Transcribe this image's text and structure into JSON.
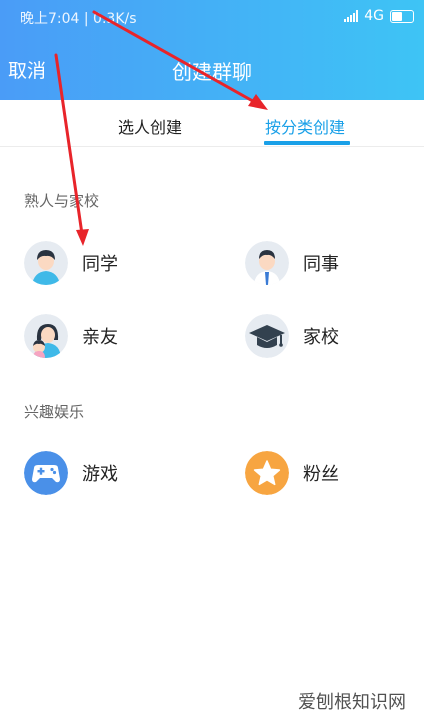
{
  "status_bar": {
    "time": "晚上7:04 | 0.3K/s",
    "network": "4G"
  },
  "header": {
    "cancel_label": "取消",
    "title": "创建群聊"
  },
  "tabs": [
    {
      "label": "选人创建"
    },
    {
      "label": "按分类创建"
    }
  ],
  "sections": [
    {
      "title": "熟人与家校",
      "items": [
        {
          "label": "同学",
          "icon": "classmate-avatar-icon"
        },
        {
          "label": "同事",
          "icon": "colleague-avatar-icon"
        },
        {
          "label": "亲友",
          "icon": "relatives-avatar-icon"
        },
        {
          "label": "家校",
          "icon": "graduation-cap-icon"
        }
      ]
    },
    {
      "title": "兴趣娱乐",
      "items": [
        {
          "label": "游戏",
          "icon": "gamepad-icon"
        },
        {
          "label": "粉丝",
          "icon": "star-icon"
        }
      ]
    }
  ],
  "watermark": "爱刨根知识网",
  "colors": {
    "accent": "#1aa0e8",
    "header_start": "#4a9cf7",
    "header_end": "#3ec4f5",
    "arrow": "#e8242a",
    "game_icon_bg": "#4a90e8",
    "star_icon_bg": "#f7a541"
  }
}
